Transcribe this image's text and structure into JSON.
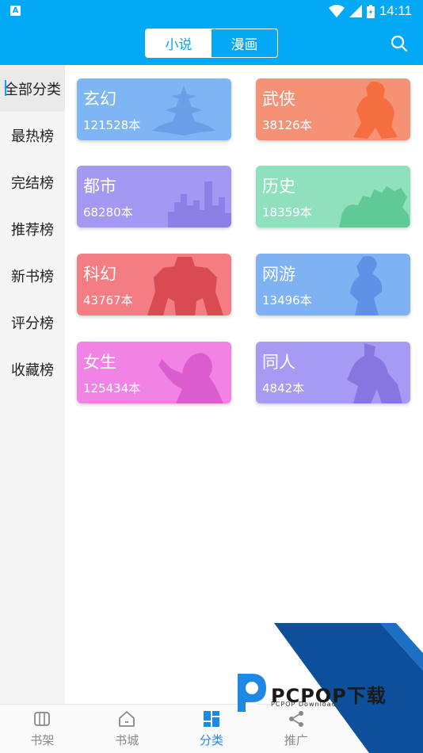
{
  "status": {
    "time": "14:11"
  },
  "header": {
    "tabs": [
      {
        "label": "小说",
        "active": true
      },
      {
        "label": "漫画",
        "active": false
      }
    ]
  },
  "sidebar": {
    "items": [
      {
        "label": "全部分类",
        "active": true
      },
      {
        "label": "最热榜"
      },
      {
        "label": "完结榜"
      },
      {
        "label": "推荐榜"
      },
      {
        "label": "新书榜"
      },
      {
        "label": "评分榜"
      },
      {
        "label": "收藏榜"
      }
    ]
  },
  "categories": [
    {
      "name": "玄幻",
      "count": "121528本",
      "color": "#7eb5f5",
      "icon": "pagoda-silhouette"
    },
    {
      "name": "武侠",
      "count": "38126本",
      "color": "#f59275",
      "icon": "warrior-silhouette"
    },
    {
      "name": "都市",
      "count": "68280本",
      "color": "#a398f2",
      "icon": "city-skyline"
    },
    {
      "name": "历史",
      "count": "18359本",
      "color": "#8fe0bd",
      "icon": "army-silhouette"
    },
    {
      "name": "科幻",
      "count": "43767本",
      "color": "#f47d84",
      "icon": "robot-silhouette"
    },
    {
      "name": "网游",
      "count": "13496本",
      "color": "#7fb2f3",
      "icon": "gamer-silhouette"
    },
    {
      "name": "女生",
      "count": "125434本",
      "color": "#f083e3",
      "icon": "woman-silhouette"
    },
    {
      "name": "同人",
      "count": "4842本",
      "color": "#a79af2",
      "icon": "anime-silhouette"
    }
  ],
  "bottom_nav": [
    {
      "label": "书架",
      "icon": "bookshelf-icon"
    },
    {
      "label": "书城",
      "icon": "home-icon"
    },
    {
      "label": "分类",
      "icon": "category-grid-icon",
      "active": true
    },
    {
      "label": "推广",
      "icon": "share-icon"
    }
  ],
  "watermark": {
    "text": "PCPOP下载",
    "subtext": "PCPOP Download"
  }
}
